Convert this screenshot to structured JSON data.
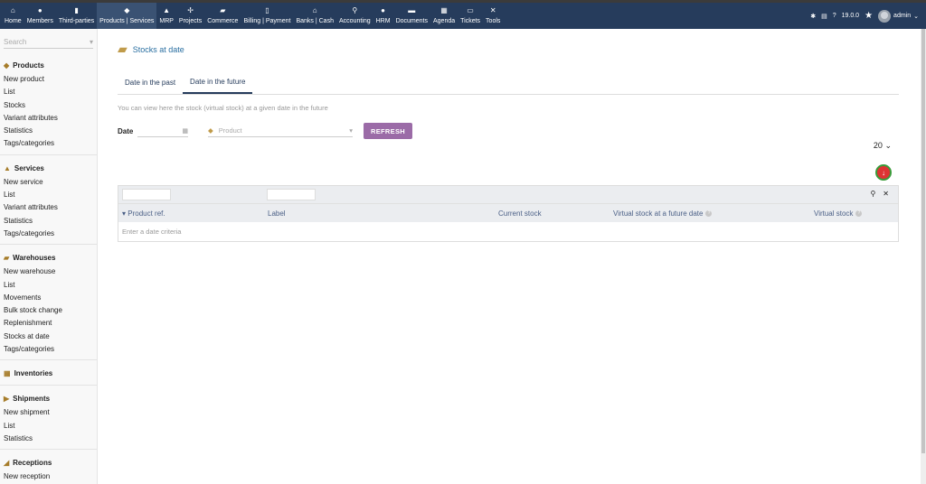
{
  "menu": [
    {
      "label": "Home",
      "icon": "home-icon",
      "glyph": "⌂"
    },
    {
      "label": "Members",
      "icon": "user-icon",
      "glyph": "●"
    },
    {
      "label": "Third-parties",
      "icon": "building-icon",
      "glyph": "▮"
    },
    {
      "label": "Products | Services",
      "icon": "cube-icon",
      "glyph": "◆"
    },
    {
      "label": "MRP",
      "icon": "cubes-icon",
      "glyph": "▲"
    },
    {
      "label": "Projects",
      "icon": "sitemap-icon",
      "glyph": "✢"
    },
    {
      "label": "Commerce",
      "icon": "briefcase-icon",
      "glyph": "▰"
    },
    {
      "label": "Billing | Payment",
      "icon": "file-invoice-icon",
      "glyph": "▯"
    },
    {
      "label": "Banks | Cash",
      "icon": "bank-icon",
      "glyph": "⌂"
    },
    {
      "label": "Accounting",
      "icon": "search-dollar-icon",
      "glyph": "⚲"
    },
    {
      "label": "HRM",
      "icon": "user-tie-icon",
      "glyph": "●"
    },
    {
      "label": "Documents",
      "icon": "folder-icon",
      "glyph": "▬"
    },
    {
      "label": "Agenda",
      "icon": "calendar-icon",
      "glyph": "▦"
    },
    {
      "label": "Tickets",
      "icon": "ticket-icon",
      "glyph": "▭"
    },
    {
      "label": "Tools",
      "icon": "tools-icon",
      "glyph": "✕"
    }
  ],
  "topright": {
    "version": "19.0.0",
    "user": "admin",
    "bug_glyph": "✱",
    "print_glyph": "▤",
    "help_glyph": "?",
    "star_glyph": "★",
    "caret_glyph": "⌄"
  },
  "sidebar": {
    "search_placeholder": "Search",
    "search_caret": "▾",
    "sections": [
      {
        "title": "Products",
        "icon": "cube-icon",
        "glyph": "◆",
        "items": [
          "New product",
          "List",
          "Stocks",
          "Variant attributes",
          "Statistics",
          "Tags/categories"
        ]
      },
      {
        "title": "Services",
        "icon": "concierge-bell-icon",
        "glyph": "▲",
        "items": [
          "New service",
          "List",
          "Variant attributes",
          "Statistics",
          "Tags/categories"
        ]
      },
      {
        "title": "Warehouses",
        "icon": "boxes-icon",
        "glyph": "▰",
        "items": [
          "New warehouse",
          "List",
          "Movements",
          "Bulk stock change",
          "Replenishment",
          "Stocks at date",
          "Tags/categories"
        ]
      },
      {
        "title": "Inventories",
        "icon": "boxes-stacked-icon",
        "glyph": "▦",
        "items": []
      },
      {
        "title": "Shipments",
        "icon": "dolly-icon",
        "glyph": "▶",
        "items": [
          "New shipment",
          "List",
          "Statistics"
        ]
      },
      {
        "title": "Receptions",
        "icon": "truck-icon",
        "glyph": "◢",
        "items": [
          "New reception",
          "List"
        ]
      }
    ]
  },
  "page": {
    "title": "Stocks at date",
    "title_glyph": "▰",
    "tabs": [
      "Date in the past",
      "Date in the future"
    ],
    "description": "You can view here the stock (virtual stock) at a given date in the future",
    "date_label": "Date",
    "calendar_glyph": "▦",
    "product_placeholder": "Product",
    "product_glyph": "◆",
    "product_caret": "▾",
    "refresh_label": "REFRESH",
    "limit_value": "20",
    "limit_caret": "⌄",
    "export_glyph": "↓",
    "search_glyph": "⚲",
    "clear_glyph": "✕",
    "help_glyph": "?",
    "sort_glyph": "▾",
    "columns": [
      "Product ref.",
      "Label",
      "Current stock",
      "Virtual stock at a future date",
      "Virtual stock"
    ],
    "empty_message": "Enter a date criteria"
  },
  "colors": {
    "topbar": "#263c5c",
    "refresh": "#9b6ba7",
    "link": "#263c5c"
  }
}
